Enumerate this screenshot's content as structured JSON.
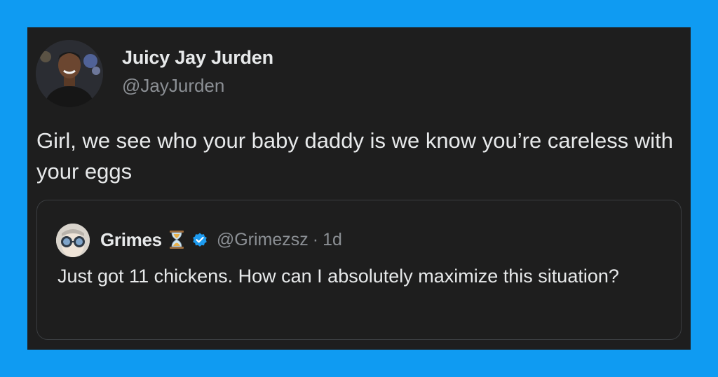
{
  "tweet": {
    "author_name": "Juicy Jay Jurden",
    "author_handle": "@JayJurden",
    "text": "Girl, we see who your baby daddy is we know you’re careless with your eggs"
  },
  "quoted_tweet": {
    "author_name": "Grimes",
    "name_emoji": "hourglass-icon",
    "verified": true,
    "author_handle": "@Grimezsz",
    "separator": "·",
    "time": "1d",
    "text": "Just got 11 chickens.  How can I absolutely maximize this situation?"
  },
  "colors": {
    "background": "#0f9bf2",
    "card": "#1e1e1e",
    "text": "#e7e9ea",
    "secondary_text": "#8b8f94",
    "border": "#3a3d40",
    "verified": "#1d9bf0"
  }
}
